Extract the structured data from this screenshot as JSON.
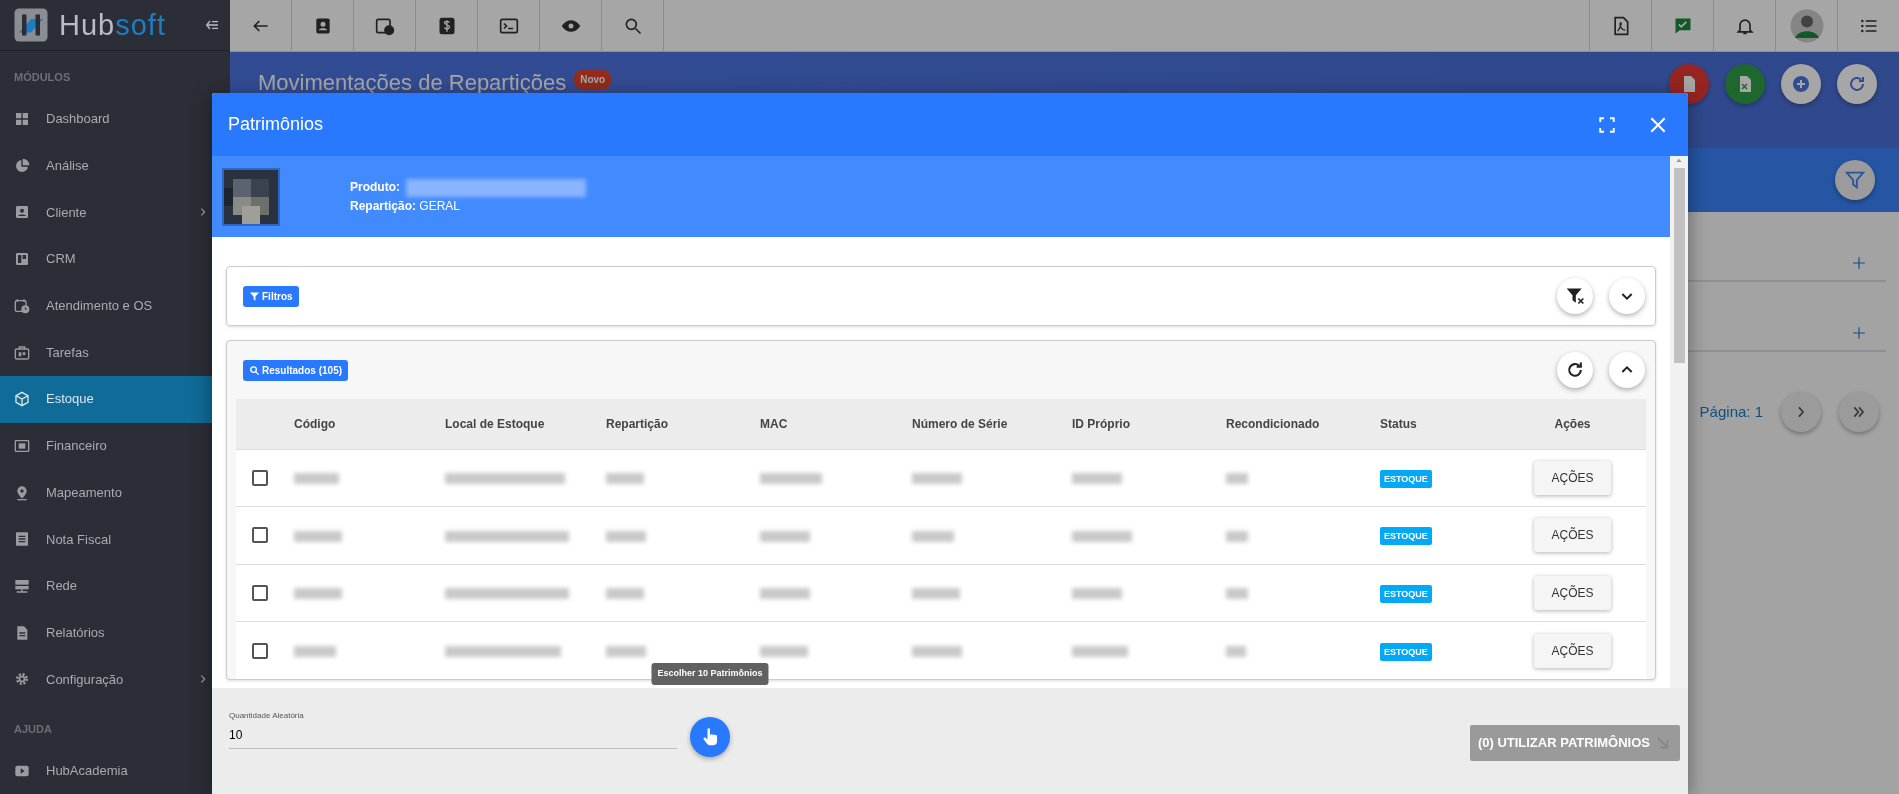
{
  "brand": {
    "first": "Hub",
    "second": "soft"
  },
  "sidebar": {
    "sections": [
      {
        "title": "MÓDULOS",
        "items": [
          {
            "label": "Dashboard",
            "selected": false,
            "expandable": false
          },
          {
            "label": "Análise",
            "selected": false,
            "expandable": false
          },
          {
            "label": "Cliente",
            "selected": false,
            "expandable": true
          },
          {
            "label": "CRM",
            "selected": false,
            "expandable": false
          },
          {
            "label": "Atendimento e OS",
            "selected": false,
            "expandable": false
          },
          {
            "label": "Tarefas",
            "selected": false,
            "expandable": false
          },
          {
            "label": "Estoque",
            "selected": true,
            "expandable": false
          },
          {
            "label": "Financeiro",
            "selected": false,
            "expandable": false
          },
          {
            "label": "Mapeamento",
            "selected": false,
            "expandable": false
          },
          {
            "label": "Nota Fiscal",
            "selected": false,
            "expandable": false
          },
          {
            "label": "Rede",
            "selected": false,
            "expandable": false
          },
          {
            "label": "Relatórios",
            "selected": false,
            "expandable": false
          },
          {
            "label": "Configuração",
            "selected": false,
            "expandable": true
          }
        ]
      },
      {
        "title": "AJUDA",
        "items": [
          {
            "label": "HubAcademia",
            "selected": false,
            "expandable": false
          }
        ]
      }
    ]
  },
  "page": {
    "title": "Movimentações de Repartições",
    "badge": "Novo",
    "pagination": "Página: 1"
  },
  "modal": {
    "title": "Patrimônios",
    "product_label": "Produto:",
    "partition": "**Repartição:** GERAL",
    "filters": {
      "label": "Filtros",
      "expanded": false
    },
    "results": {
      "label": "Resultados (105)",
      "expanded": true
    },
    "table": {
      "columns": [
        "Código",
        "Local de Estoque",
        "Repartição",
        "MAC",
        "Número de Série",
        "ID Próprio",
        "Recondicionado",
        "Status",
        "Ações"
      ],
      "rows": [
        {
          "selected": false,
          "status": "ESTOQUE",
          "action": "AÇÕES"
        },
        {
          "selected": false,
          "status": "ESTOQUE",
          "action": "AÇÕES"
        },
        {
          "selected": false,
          "status": "ESTOQUE",
          "action": "AÇÕES"
        },
        {
          "selected": false,
          "status": "ESTOQUE",
          "action": "AÇÕES"
        }
      ]
    },
    "footer": {
      "quantity_label": "Quantidade Aleatória",
      "quantity_value": "10",
      "tooltip": "Escolher 10 Patrimônios",
      "use_button": {
        "label": "(0) UTILIZAR PATRIMÔNIOS",
        "disabled": true
      }
    }
  }
}
